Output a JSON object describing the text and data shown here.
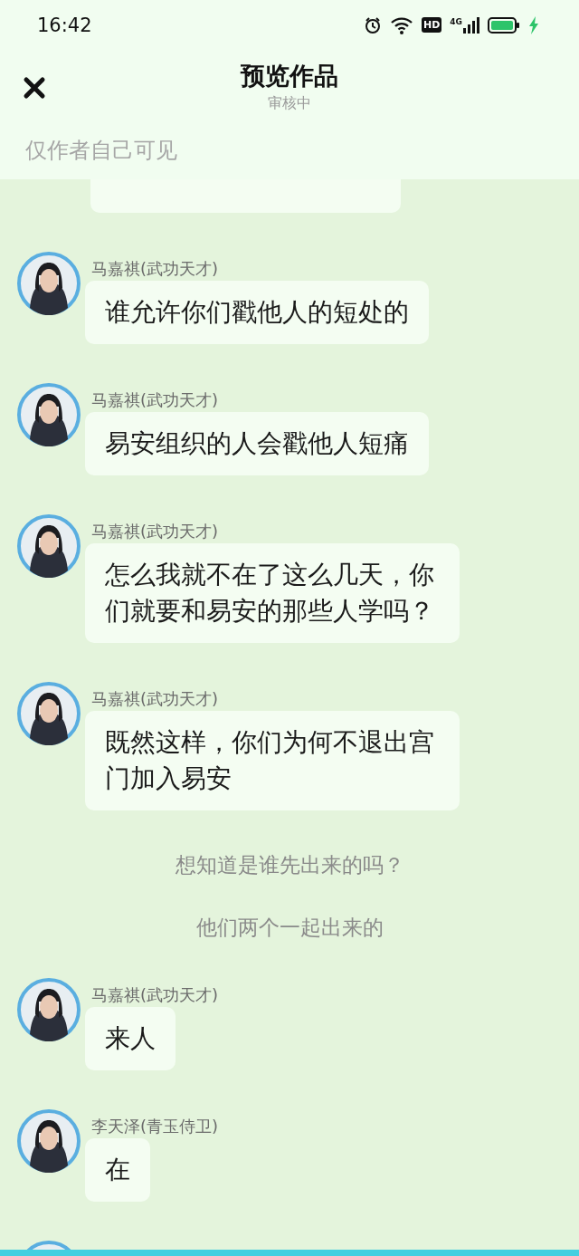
{
  "status_bar": {
    "time": "16:42",
    "hd_badge": "HD",
    "network": "4G"
  },
  "header": {
    "title": "预览作品",
    "subtitle": "审核中",
    "visibility_note": "仅作者自己可见"
  },
  "chat": [
    {
      "kind": "message",
      "sender": "马嘉祺(武功天才)",
      "text": "谁允许你们戳他人的短处的"
    },
    {
      "kind": "message",
      "sender": "马嘉祺(武功天才)",
      "text": "易安组织的人会戳他人短痛"
    },
    {
      "kind": "message",
      "sender": "马嘉祺(武功天才)",
      "text": "怎么我就不在了这么几天，你们就要和易安的那些人学吗？"
    },
    {
      "kind": "message",
      "sender": "马嘉祺(武功天才)",
      "text": "既然这样，你们为何不退出宫门加入易安"
    },
    {
      "kind": "narration",
      "text": "想知道是谁先出来的吗？"
    },
    {
      "kind": "narration",
      "text": "他们两个一起出来的"
    },
    {
      "kind": "message",
      "sender": "马嘉祺(武功天才)",
      "text": "来人"
    },
    {
      "kind": "message",
      "sender": "李天泽(青玉侍卫)",
      "text": "在"
    }
  ]
}
